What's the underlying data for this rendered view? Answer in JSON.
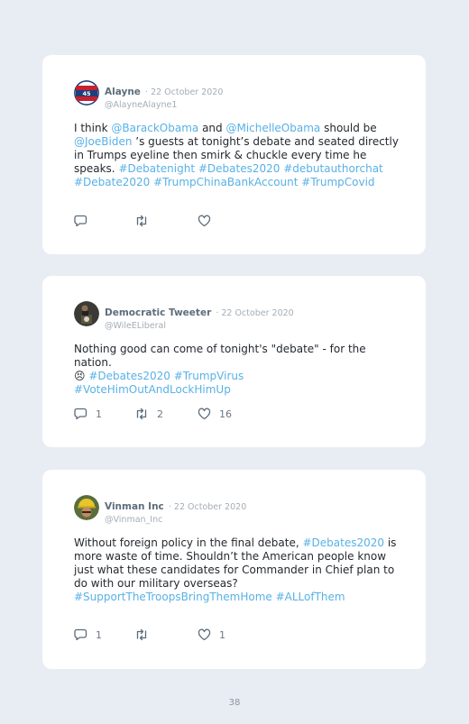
{
  "tweets": [
    {
      "name": "Alayne",
      "date": "· 22 October 2020",
      "handle": "@AlayneAlayne1",
      "counts": {
        "reply": "",
        "retweet": "",
        "like": ""
      }
    },
    {
      "name": "Democratic Tweeter",
      "date": "· 22 October 2020",
      "handle": "@WileELiberal",
      "counts": {
        "reply": "1",
        "retweet": "2",
        "like": "16"
      }
    },
    {
      "name": "Vinman Inc",
      "date": "· 22 October 2020",
      "handle": "@Vinman_Inc",
      "counts": {
        "reply": "1",
        "retweet": "",
        "like": "1"
      }
    }
  ],
  "t1": {
    "s1": "I think ",
    "h1": "@BarackObama",
    "s2": " and ",
    "h2": "@MichelleObama",
    "s3": " should be ",
    "h3": "@JoeBiden",
    "s4": " ’s guests at tonight’s debate and seated directly in Trumps eyeline then smirk & chuckle every time he speaks. ",
    "h4": "#Debatenight",
    "h5": "#Debates2020",
    "h6": "#debutauthorchat",
    "h7": "#Debate2020",
    "h8": "#TrumpChinaBankAccount",
    "h9": "#TrumpCovid"
  },
  "t2": {
    "s1": "Nothing good can come of tonight's \"debate\" - for the nation.",
    "emoji": "😣",
    "h1": "#Debates2020",
    "h2": "#TrumpVirus",
    "h3": "#VoteHimOutAndLockHimUp"
  },
  "t3": {
    "s1": "Without foreign policy in the final debate, ",
    "h1": "#Debates2020",
    "s2": " is more waste of time. Shouldn’t the American people know just what these candidates for Commander in Chief plan to do with our military overseas? ",
    "h2": "#SupportTheTroopsBringThemHome",
    "h3": "#ALLofThem"
  },
  "page_number": "38"
}
